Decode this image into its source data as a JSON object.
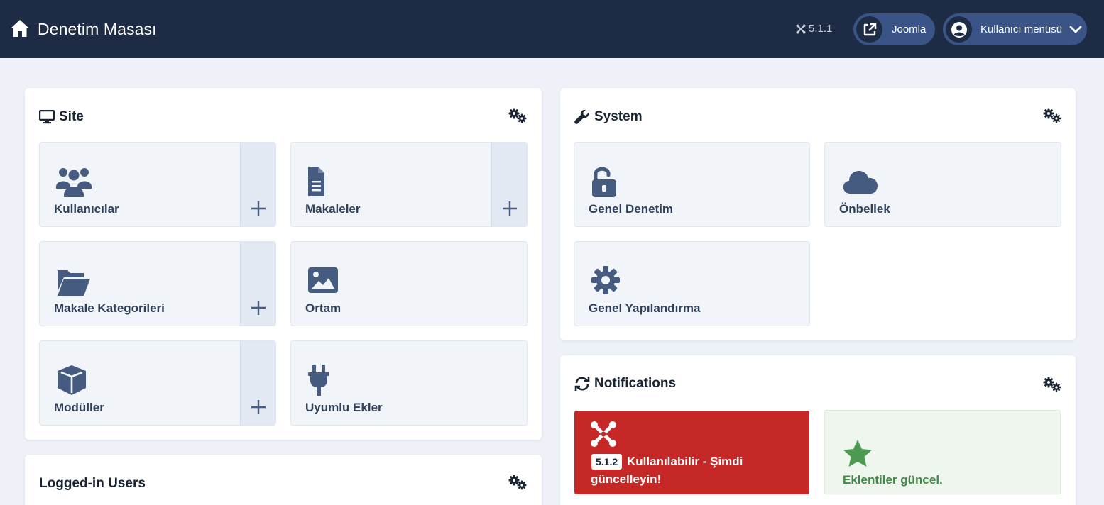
{
  "header": {
    "title": "Denetim Masası",
    "version": "5.1.1",
    "joomla_label": "Joomla",
    "user_menu_label": "Kullanıcı menüsü"
  },
  "site_panel": {
    "title": "Site",
    "tiles": [
      {
        "label": "Kullanıcılar",
        "icon": "users-icon",
        "has_add": true
      },
      {
        "label": "Makaleler",
        "icon": "file-alt-icon",
        "has_add": true
      },
      {
        "label": "Makale Kategorileri",
        "icon": "folder-open-icon",
        "has_add": true
      },
      {
        "label": "Ortam",
        "icon": "image-icon",
        "has_add": false
      },
      {
        "label": "Modüller",
        "icon": "cube-icon",
        "has_add": true
      },
      {
        "label": "Uyumlu Ekler",
        "icon": "plug-icon",
        "has_add": false
      }
    ]
  },
  "system_panel": {
    "title": "System",
    "tiles": [
      {
        "label": "Genel Denetim",
        "icon": "unlock-icon"
      },
      {
        "label": "Önbellek",
        "icon": "cloud-icon"
      },
      {
        "label": "Genel Yapılandırma",
        "icon": "cog-icon"
      }
    ]
  },
  "notifications_panel": {
    "title": "Notifications",
    "update_badge": "5.1.2",
    "update_text_1": "Kullanılabilir - Şimdi",
    "update_text_2": "güncelleyin!",
    "extensions_text": "Eklentiler güncel."
  },
  "logged_in_panel": {
    "title": "Logged-in Users"
  },
  "colors": {
    "header_bg": "#1e2b44",
    "header_button": "#3a5488",
    "tile_icon": "#455b80",
    "danger": "#c52827",
    "success": "#3f8a46"
  }
}
